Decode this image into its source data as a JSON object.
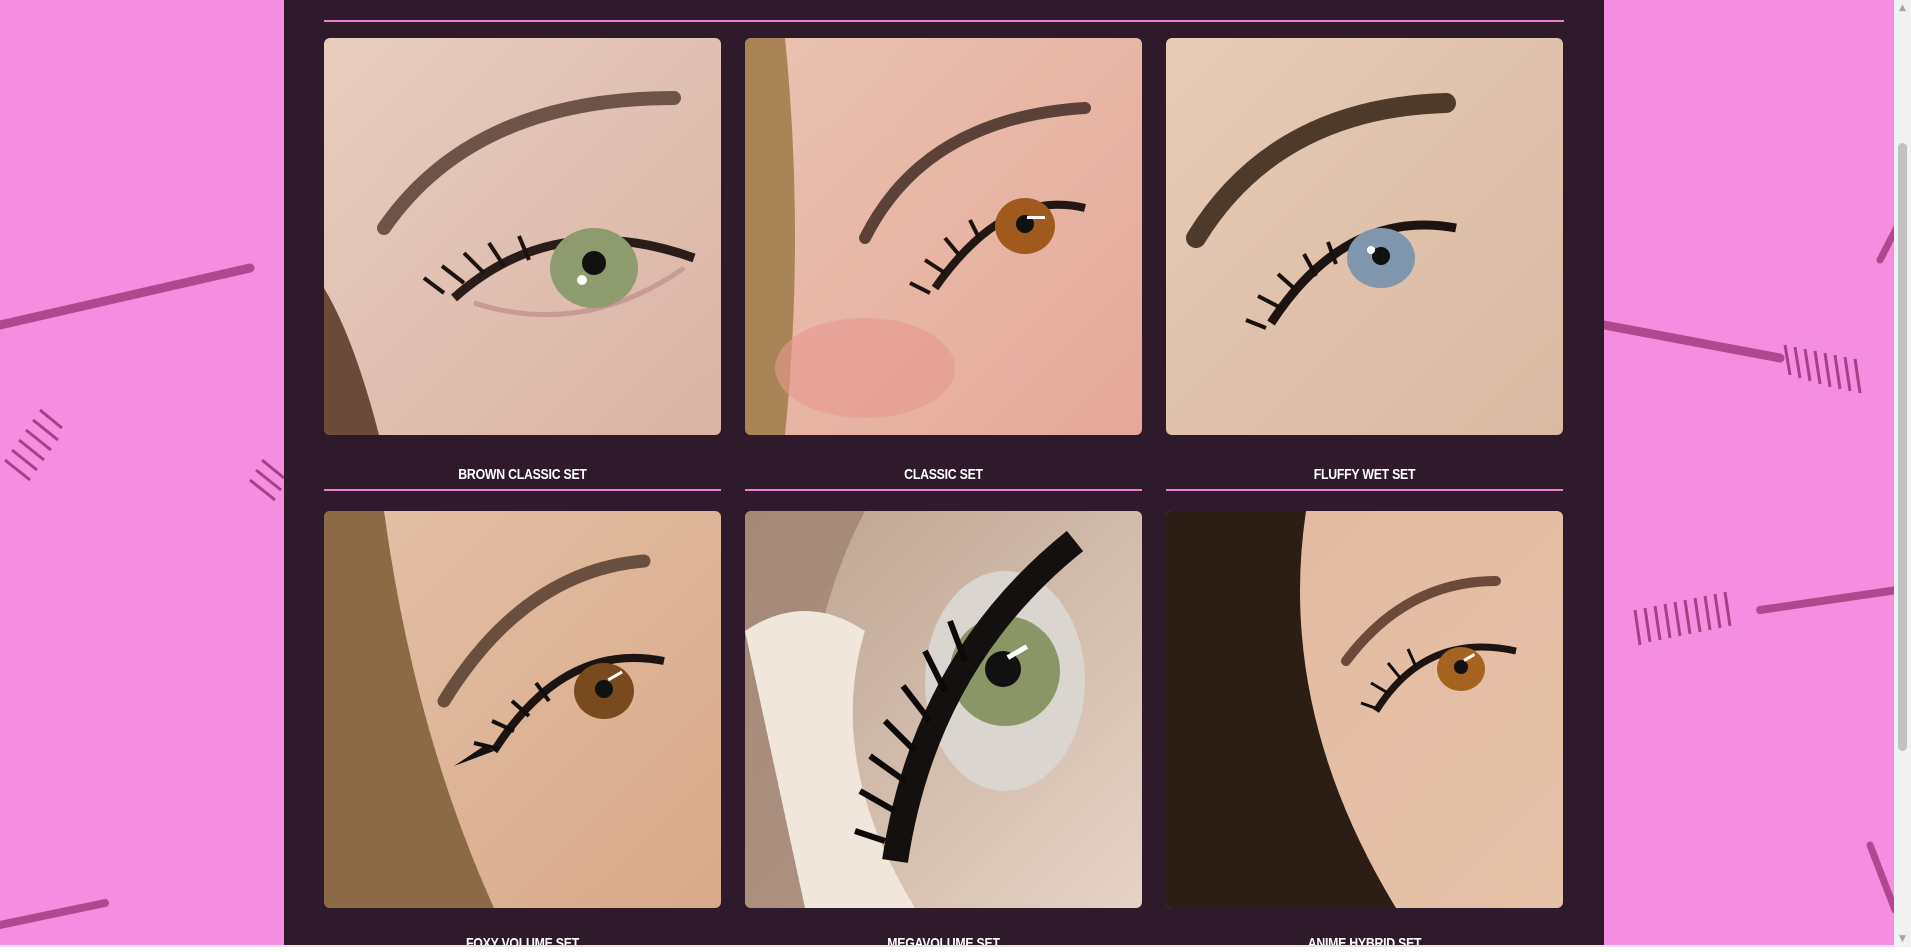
{
  "colors": {
    "page_background": "#f58ee0",
    "panel_background": "#2f1a2c",
    "divider": "#f07ccd",
    "caption_text": "#ffffff"
  },
  "gallery": {
    "items": [
      {
        "label": "BROWN CLASSIC SET",
        "image": "eye-photo-green-eye"
      },
      {
        "label": "CLASSIC SET",
        "image": "eye-photo-amber-eye"
      },
      {
        "label": "FLUFFY WET SET",
        "image": "eye-photo-blue-eye"
      },
      {
        "label": "FOXY VOLUME SET",
        "image": "eye-photo-brown-eye"
      },
      {
        "label": "MEGAVOLUME SET",
        "image": "eye-photo-macro-lashes"
      },
      {
        "label": "ANIME HYBRID SET",
        "image": "eye-photo-hazel-eye"
      }
    ]
  },
  "scrollbar": {
    "up_arrow_icon": "chevron-up-icon",
    "down_arrow_icon": "chevron-down-icon"
  }
}
